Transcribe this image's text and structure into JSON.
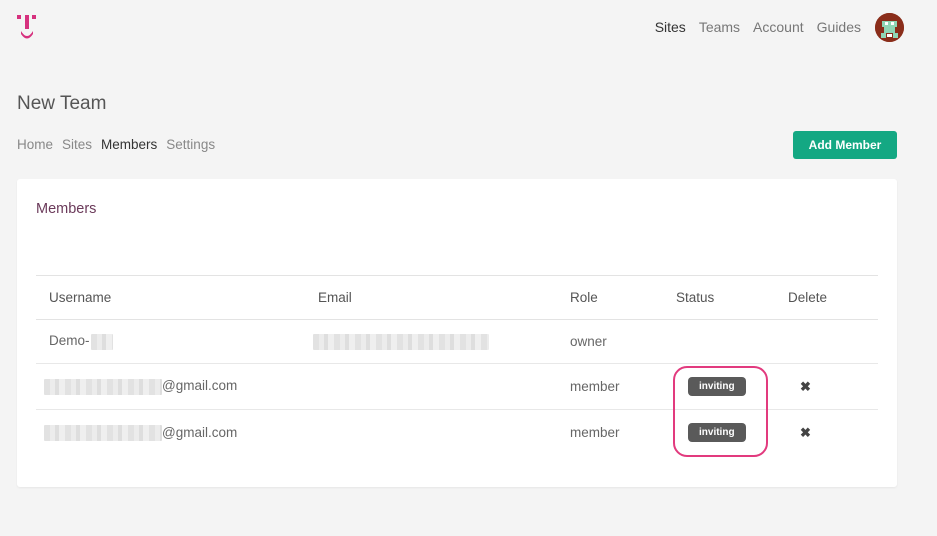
{
  "header": {
    "nav": [
      {
        "label": "Sites",
        "active": true
      },
      {
        "label": "Teams",
        "active": false
      },
      {
        "label": "Account",
        "active": false
      },
      {
        "label": "Guides",
        "active": false
      }
    ]
  },
  "page": {
    "title": "New Team",
    "tabs": [
      {
        "label": "Home"
      },
      {
        "label": "Sites"
      },
      {
        "label": "Members",
        "active": true
      },
      {
        "label": "Settings"
      }
    ],
    "add_member_label": "Add Member"
  },
  "members": {
    "title": "Members",
    "columns": [
      "Username",
      "Email",
      "Role",
      "Status",
      "Delete"
    ],
    "rows": [
      {
        "username": "Demo-",
        "role": "owner",
        "status": ""
      },
      {
        "username": "@gmail.com",
        "role": "member",
        "status": "inviting"
      },
      {
        "username": "@gmail.com",
        "role": "member",
        "status": "inviting"
      }
    ]
  },
  "colors": {
    "accent": "#14a883",
    "brand": "#d6317e",
    "highlight": "#e23a7e",
    "badge": "#5a5a5a"
  },
  "icons": {
    "delete": "close-icon"
  }
}
